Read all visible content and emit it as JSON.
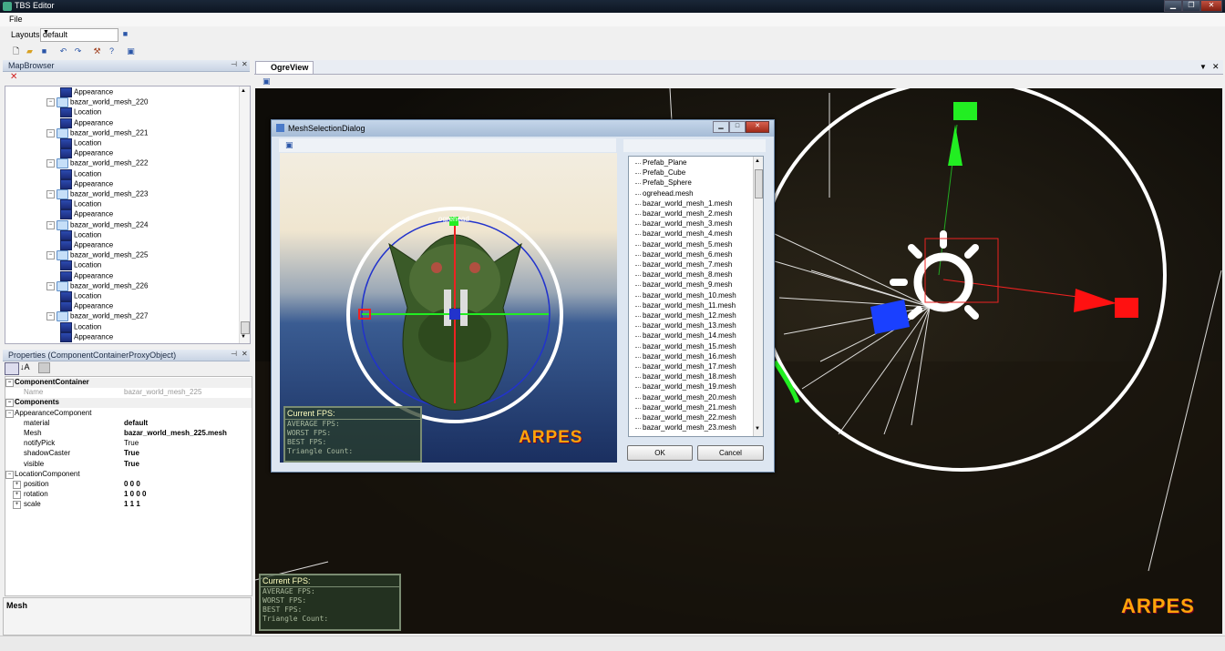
{
  "window": {
    "title": "TBS Editor"
  },
  "menu": {
    "file": "File"
  },
  "toolbar": {
    "layouts_label": "Layouts",
    "layout_value": "default"
  },
  "mapbrowser": {
    "title": "MapBrowser",
    "items": [
      {
        "label": "Appearance",
        "kind": "doc"
      },
      {
        "label": "bazar_world_mesh_220",
        "kind": "folder"
      },
      {
        "label": "Location",
        "kind": "doc"
      },
      {
        "label": "Appearance",
        "kind": "doc"
      },
      {
        "label": "bazar_world_mesh_221",
        "kind": "folder"
      },
      {
        "label": "Location",
        "kind": "doc"
      },
      {
        "label": "Appearance",
        "kind": "doc"
      },
      {
        "label": "bazar_world_mesh_222",
        "kind": "folder"
      },
      {
        "label": "Location",
        "kind": "doc"
      },
      {
        "label": "Appearance",
        "kind": "doc"
      },
      {
        "label": "bazar_world_mesh_223",
        "kind": "folder"
      },
      {
        "label": "Location",
        "kind": "doc"
      },
      {
        "label": "Appearance",
        "kind": "doc"
      },
      {
        "label": "bazar_world_mesh_224",
        "kind": "folder"
      },
      {
        "label": "Location",
        "kind": "doc"
      },
      {
        "label": "Appearance",
        "kind": "doc"
      },
      {
        "label": "bazar_world_mesh_225",
        "kind": "folder"
      },
      {
        "label": "Location",
        "kind": "doc"
      },
      {
        "label": "Appearance",
        "kind": "doc"
      },
      {
        "label": "bazar_world_mesh_226",
        "kind": "folder"
      },
      {
        "label": "Location",
        "kind": "doc"
      },
      {
        "label": "Appearance",
        "kind": "doc"
      },
      {
        "label": "bazar_world_mesh_227",
        "kind": "folder"
      },
      {
        "label": "Location",
        "kind": "doc"
      },
      {
        "label": "Appearance",
        "kind": "doc"
      }
    ]
  },
  "properties": {
    "title": "Properties (ComponentContainerProxyObject)",
    "rows": [
      {
        "key": "ComponentContainer",
        "value": "",
        "type": "cat"
      },
      {
        "key": "Name",
        "value": "bazar_world_mesh_225",
        "type": "disabled"
      },
      {
        "key": "Components",
        "value": "",
        "type": "cat"
      },
      {
        "key": "AppearanceComponent",
        "value": "",
        "type": "sub"
      },
      {
        "key": "material",
        "value": "default",
        "type": "bold"
      },
      {
        "key": "Mesh",
        "value": "bazar_world_mesh_225.mesh",
        "type": "bold"
      },
      {
        "key": "notifyPick",
        "value": "True",
        "type": "plain"
      },
      {
        "key": "shadowCaster",
        "value": "True",
        "type": "bold"
      },
      {
        "key": "visible",
        "value": "True",
        "type": "bold"
      },
      {
        "key": "LocationComponent",
        "value": "",
        "type": "sub"
      },
      {
        "key": "position",
        "value": "0 0 0",
        "type": "expand"
      },
      {
        "key": "rotation",
        "value": "1 0 0 0",
        "type": "expand"
      },
      {
        "key": "scale",
        "value": "1 1 1",
        "type": "expand"
      }
    ],
    "description": "Mesh"
  },
  "ogreview": {
    "tab": "OgreView"
  },
  "fps": {
    "current": "Current FPS:",
    "average": "AVERAGE FPS:",
    "worst": "WORST FPS:",
    "best": "BEST FPS:",
    "triangles": "Triangle Count:"
  },
  "logo": "ARPES",
  "dialog": {
    "title": "MeshSelectionDialog",
    "ok": "OK",
    "cancel": "Cancel",
    "gizmo_label": "ogrehead",
    "meshes": [
      "Prefab_Plane",
      "Prefab_Cube",
      "Prefab_Sphere",
      "ogrehead.mesh",
      "bazar_world_mesh_1.mesh",
      "bazar_world_mesh_2.mesh",
      "bazar_world_mesh_3.mesh",
      "bazar_world_mesh_4.mesh",
      "bazar_world_mesh_5.mesh",
      "bazar_world_mesh_6.mesh",
      "bazar_world_mesh_7.mesh",
      "bazar_world_mesh_8.mesh",
      "bazar_world_mesh_9.mesh",
      "bazar_world_mesh_10.mesh",
      "bazar_world_mesh_11.mesh",
      "bazar_world_mesh_12.mesh",
      "bazar_world_mesh_13.mesh",
      "bazar_world_mesh_14.mesh",
      "bazar_world_mesh_15.mesh",
      "bazar_world_mesh_16.mesh",
      "bazar_world_mesh_17.mesh",
      "bazar_world_mesh_18.mesh",
      "bazar_world_mesh_19.mesh",
      "bazar_world_mesh_20.mesh",
      "bazar_world_mesh_21.mesh",
      "bazar_world_mesh_22.mesh",
      "bazar_world_mesh_23.mesh"
    ]
  }
}
